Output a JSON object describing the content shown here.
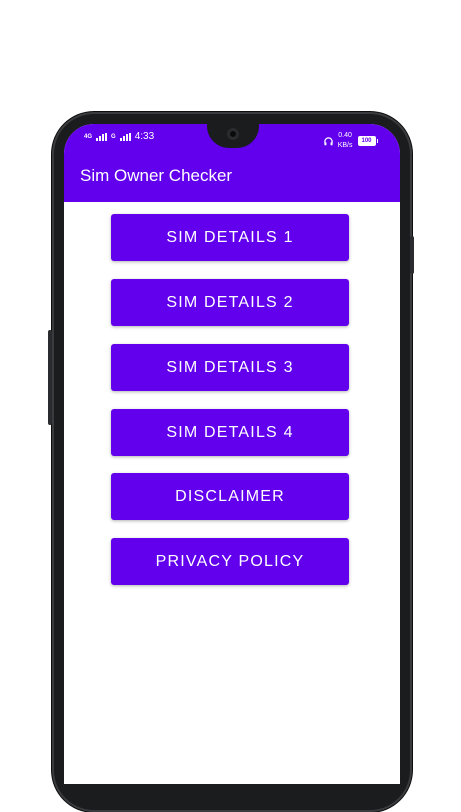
{
  "status_bar": {
    "network_1": "4G",
    "network_2": "G",
    "time": "4:33",
    "speed": "0.40",
    "speed_unit": "KB/s",
    "battery": "100"
  },
  "app_bar": {
    "title": "Sim Owner Checker"
  },
  "buttons": [
    {
      "label": "SIM DETAILS 1"
    },
    {
      "label": "SIM DETAILS 2"
    },
    {
      "label": "SIM DETAILS 3"
    },
    {
      "label": "SIM DETAILS 4"
    },
    {
      "label": "DISCLAIMER"
    },
    {
      "label": "PRIVACY POLICY"
    }
  ],
  "colors": {
    "primary": "#6200ee",
    "background": "#ffffff",
    "phone_frame": "#1b1c1e"
  }
}
